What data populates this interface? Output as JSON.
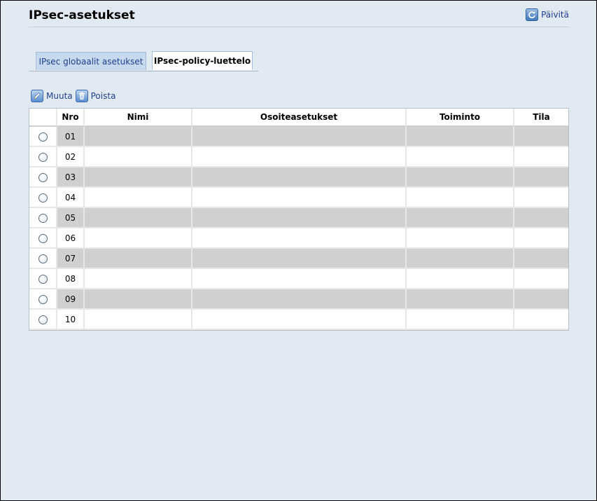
{
  "header": {
    "title": "IPsec-asetukset",
    "refresh_label": "Päivitä",
    "refresh_icon": "refresh-icon"
  },
  "tabs": [
    {
      "label": "IPsec globaalit asetukset",
      "active": false
    },
    {
      "label": "IPsec-policy-luettelo",
      "active": true
    }
  ],
  "toolbar": {
    "edit_label": "Muuta",
    "edit_icon": "pencil-icon",
    "delete_label": "Poista",
    "delete_icon": "trash-icon"
  },
  "table": {
    "columns": [
      "",
      "Nro",
      "Nimi",
      "Osoiteasetukset",
      "Toiminto",
      "Tila"
    ],
    "rows": [
      {
        "nro": "01",
        "name": "",
        "address": "",
        "action": "",
        "status": ""
      },
      {
        "nro": "02",
        "name": "",
        "address": "",
        "action": "",
        "status": ""
      },
      {
        "nro": "03",
        "name": "",
        "address": "",
        "action": "",
        "status": ""
      },
      {
        "nro": "04",
        "name": "",
        "address": "",
        "action": "",
        "status": ""
      },
      {
        "nro": "05",
        "name": "",
        "address": "",
        "action": "",
        "status": ""
      },
      {
        "nro": "06",
        "name": "",
        "address": "",
        "action": "",
        "status": ""
      },
      {
        "nro": "07",
        "name": "",
        "address": "",
        "action": "",
        "status": ""
      },
      {
        "nro": "08",
        "name": "",
        "address": "",
        "action": "",
        "status": ""
      },
      {
        "nro": "09",
        "name": "",
        "address": "",
        "action": "",
        "status": ""
      },
      {
        "nro": "10",
        "name": "",
        "address": "",
        "action": "",
        "status": ""
      }
    ]
  },
  "colors": {
    "background": "#e1e9f2",
    "link": "#1f3f8f",
    "row_shade": "#d0d0d0",
    "active_tab": "#ffffff",
    "inactive_tab": "#c7d9ee"
  }
}
